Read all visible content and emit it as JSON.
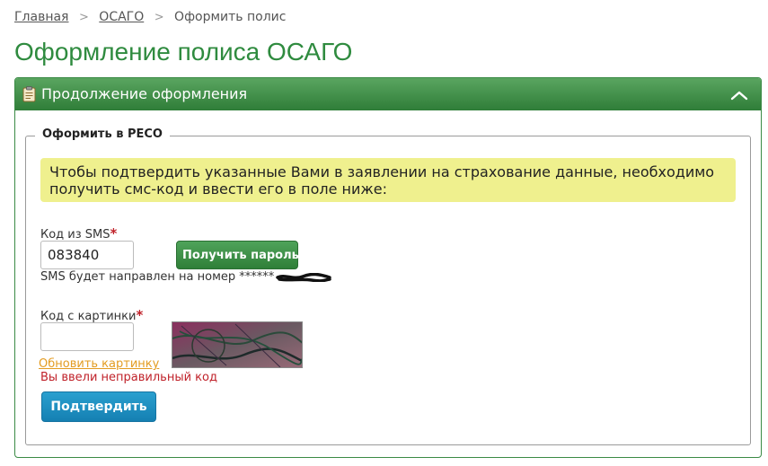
{
  "breadcrumb": {
    "items": [
      "Главная",
      "ОСАГО"
    ],
    "current": "Оформить полис"
  },
  "page": {
    "title": "Оформление полиса ОСАГО"
  },
  "panel": {
    "title": "Продолжение оформления",
    "fieldset_legend": "Оформить в РЕСО",
    "notice": "Чтобы подтвердить указанные Вами в заявлении на страхование данные, необходимо получить смс-код и ввести его в поле ниже:",
    "sms": {
      "label": "Код из SMS",
      "required_mark": "*",
      "value": "083840",
      "get_password_label": "Получить пароль",
      "hint": "SMS будет направлен на номер ******"
    },
    "captcha": {
      "label": "Код с картинки",
      "required_mark": "*",
      "value": "",
      "refresh_label": "Обновить картинку",
      "error": "Вы ввели неправильный код"
    },
    "confirm_label": "Подтвердить"
  },
  "colors": {
    "brand_green": "#2f8b3f",
    "notice_yellow": "#eff08e",
    "confirm_blue": "#1a8fc2",
    "error_red": "#c0222a",
    "link_orange": "#e39c22"
  }
}
